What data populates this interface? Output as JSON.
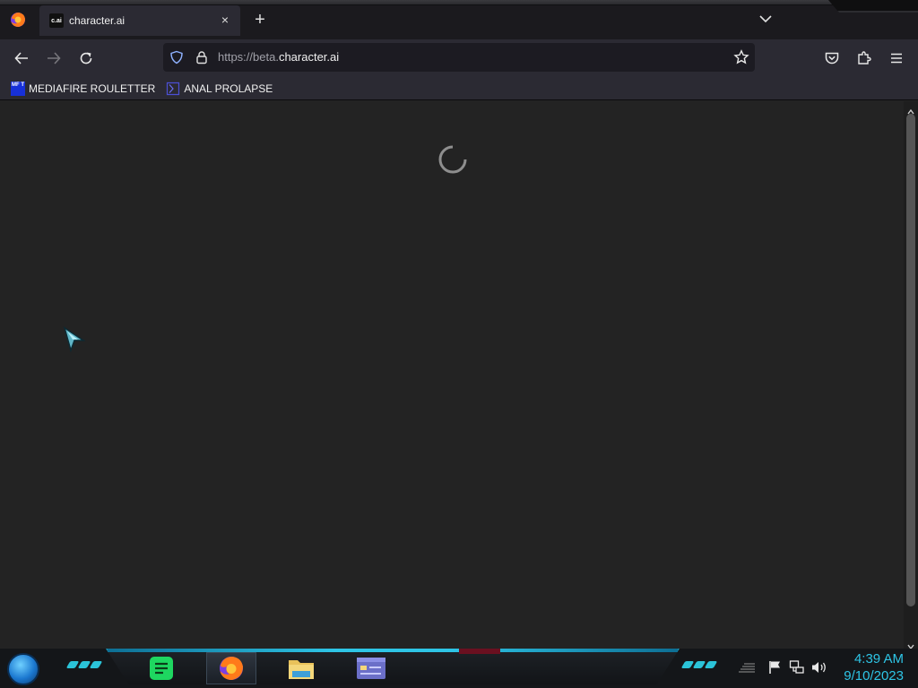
{
  "tab": {
    "favicon_text": "c.ai",
    "title": "character.ai",
    "close_glyph": "×",
    "new_tab_glyph": "+"
  },
  "urlbar": {
    "url_prefix": "https://beta.",
    "url_host": "character.ai"
  },
  "bookmarks": [
    {
      "icon_text": "MF T",
      "label": "MEDIAFIRE ROULETTER"
    },
    {
      "label": "ANAL PROLAPSE"
    }
  ],
  "clock": {
    "time": "4:39 AM",
    "date": "9/10/2023"
  },
  "colors": {
    "accent": "#2ec5e6",
    "content_bg": "#232323",
    "toolbar_bg": "#2b2a33"
  }
}
